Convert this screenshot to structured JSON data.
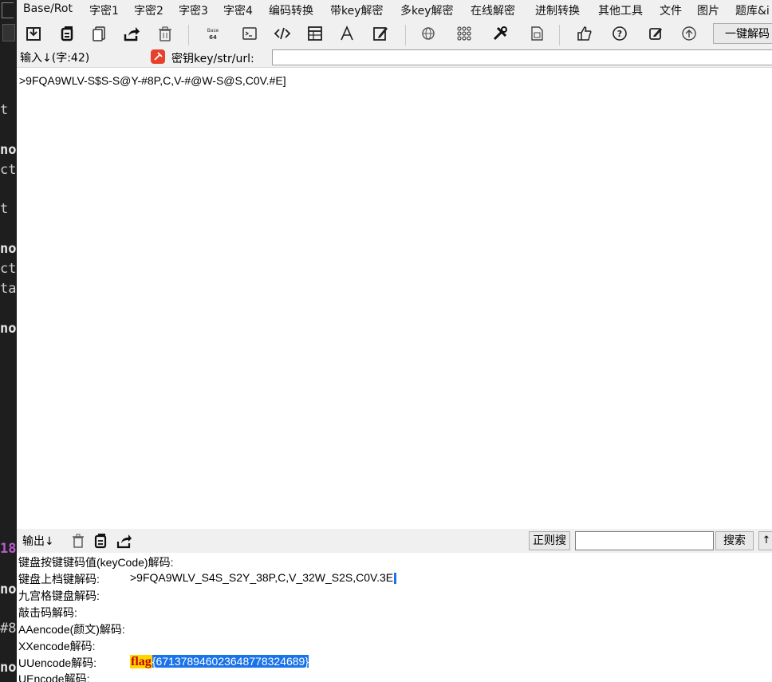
{
  "background_window": {
    "fragments": [
      "t",
      "no",
      "ct",
      "t",
      "no",
      "ct",
      "ta",
      "no",
      "18",
      "no",
      "#8",
      "no"
    ]
  },
  "menu": {
    "items": [
      "Base/Rot",
      "字密1",
      "字密2",
      "字密3",
      "字密4",
      "编码转换",
      "带key解密",
      "多key解密",
      "在线解密",
      "进制转换",
      "其他工具",
      "文件",
      "图片",
      "题库&i"
    ]
  },
  "toolbar": {
    "icons": [
      "import-icon",
      "copy-icon",
      "paste-icon",
      "share-icon",
      "trash-icon",
      "base64-icon",
      "terminal-icon",
      "code-icon",
      "table-icon",
      "font-icon",
      "edit-icon",
      "globe-icon",
      "grid-icon",
      "tools-icon",
      "doc-icon",
      "thumbs-up-icon",
      "help-icon",
      "note-icon",
      "upload-icon"
    ],
    "base_icon_text": "Base",
    "oneclick_label": "一键解码"
  },
  "input": {
    "label": "输入↓(字:42)",
    "key_label": "密钥key/str/url:",
    "key_value": "",
    "text": ">9FQA9WLV-S$S-S@Y-#8P,C,V-#@W-S@S,C0V.#E]"
  },
  "output": {
    "label": "输出↓",
    "regex_label": "正则搜",
    "search_value": "",
    "search_label": "搜索",
    "up_label": "↑",
    "rows": [
      {
        "label": "键盘按键键码值(keyCode)解码:",
        "value": ""
      },
      {
        "label": "键盘上档键解码:",
        "value": ">9FQA9WLV_S4S_S2Y_38P,C,V_32W_S2S,C0V.3E"
      },
      {
        "label": "九宫格键盘解码:",
        "value": ""
      },
      {
        "label": "敲击码解码:",
        "value": ""
      },
      {
        "label": "AAencode(颜文)解码:",
        "value": ""
      },
      {
        "label": "XXencode解码:",
        "value": ""
      },
      {
        "label": "UUencode解码:",
        "flag_word": "flag",
        "flag_body": "{6713789460236487783246​89}"
      },
      {
        "label": "UEncode解码:",
        "value": ""
      }
    ]
  },
  "colors": {
    "selection": "#1a73e8",
    "flag_highlight": "#ffd700",
    "flag_text": "#c00000",
    "key_icon": "#e8402a"
  }
}
